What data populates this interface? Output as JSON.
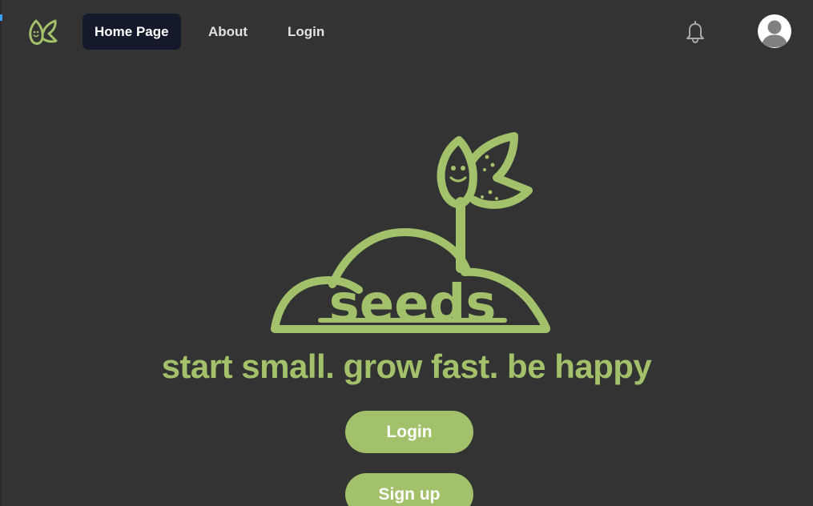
{
  "nav": {
    "items": [
      {
        "label": "Home Page",
        "active": true
      },
      {
        "label": "About",
        "active": false
      },
      {
        "label": "Login",
        "active": false
      }
    ],
    "notifications_icon": "bell-icon",
    "avatar_icon": "user-avatar-icon"
  },
  "hero": {
    "logo_text": "seeds",
    "tagline": "start small. grow fast. be happy",
    "login_label": "Login",
    "signup_label": "Sign up"
  },
  "colors": {
    "background": "#333333",
    "brand_green": "#a3c16a",
    "active_nav": "#141a2b",
    "nav_text": "#e2e2e2"
  }
}
